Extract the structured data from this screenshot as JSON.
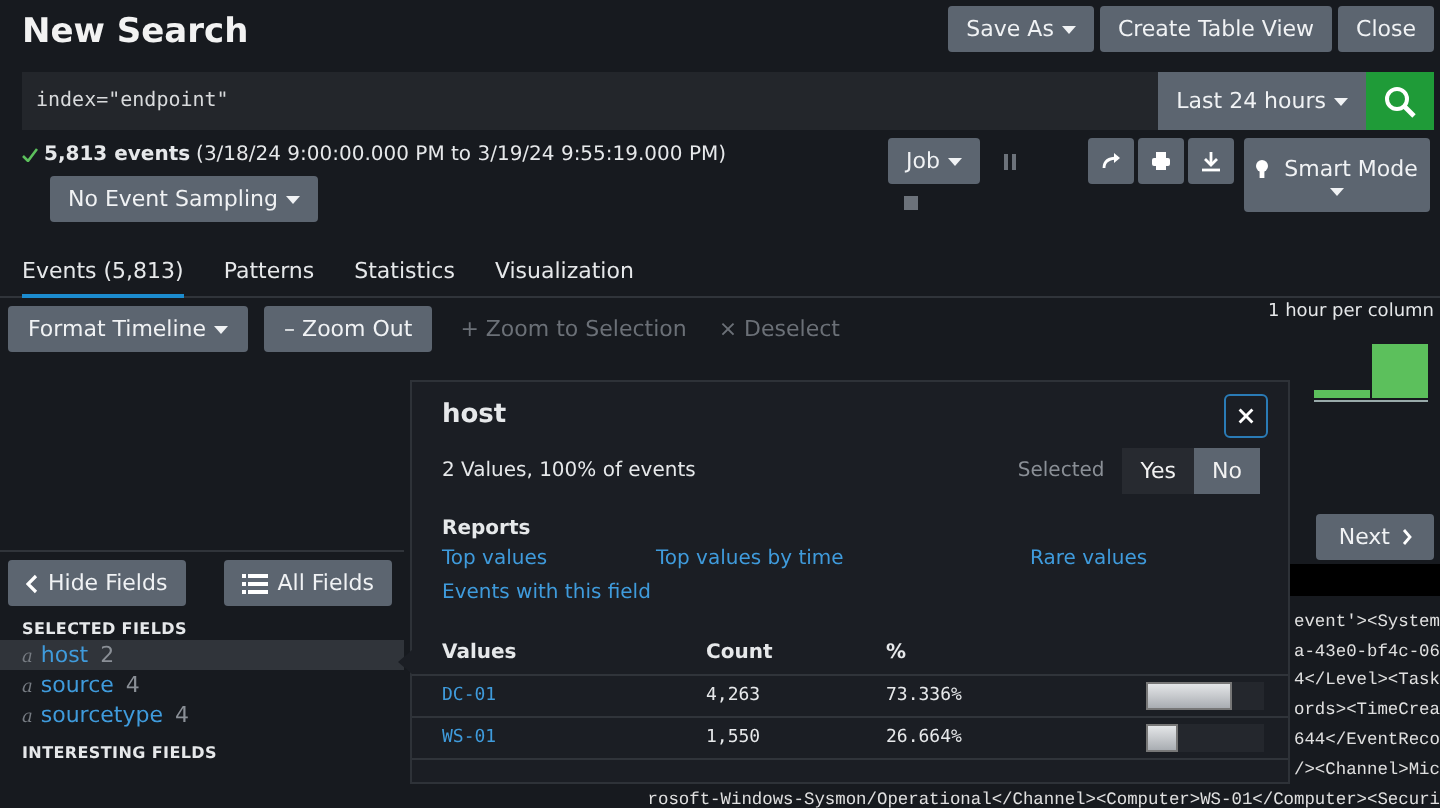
{
  "page": {
    "title": "New Search"
  },
  "header_buttons": [
    {
      "label": "Save As",
      "dropdown": true
    },
    {
      "label": "Create Table View",
      "dropdown": false
    },
    {
      "label": "Close",
      "dropdown": false
    }
  ],
  "search": {
    "query": "index=\"endpoint\"",
    "time_range": "Last 24 hours"
  },
  "job_status": {
    "count": "5,813 events",
    "range": "(3/18/24 9:00:00.000 PM to 3/19/24 9:55:19.000 PM)",
    "sampling": "No Event Sampling",
    "job": "Job",
    "mode": "Smart Mode"
  },
  "tabs": [
    {
      "label": "Events (5,813)",
      "selected": true
    },
    {
      "label": "Patterns",
      "selected": false
    },
    {
      "label": "Statistics",
      "selected": false
    },
    {
      "label": "Visualization",
      "selected": false
    }
  ],
  "timeline_toolbar": [
    {
      "label": "Format Timeline",
      "dropdown": true,
      "disabled": false
    },
    {
      "glyph": "–",
      "label": "Zoom Out",
      "dropdown": false,
      "disabled": false
    },
    {
      "glyph": "+",
      "label": "Zoom to Selection",
      "dropdown": false,
      "disabled": true
    },
    {
      "glyph": "×",
      "label": "Deselect",
      "dropdown": false,
      "disabled": true
    }
  ],
  "timeline": {
    "scale": "1 hour per column"
  },
  "pagination": {
    "next": "Next"
  },
  "sidebar": {
    "hide_fields": "Hide Fields",
    "all_fields": "All Fields",
    "sections": [
      {
        "heading": "SELECTED FIELDS",
        "fields": [
          {
            "type": "a",
            "name": "host",
            "count": "2",
            "selected": true
          },
          {
            "type": "a",
            "name": "source",
            "count": "4",
            "selected": false
          },
          {
            "type": "a",
            "name": "sourcetype",
            "count": "4",
            "selected": false
          }
        ]
      },
      {
        "heading": "INTERESTING FIELDS"
      }
    ]
  },
  "events": {
    "lines": [
      "event'><System",
      "a-43e0-bf4c-06",
      "4</Level><Task",
      "ords><TimeCrea",
      "644</EventReco",
      "/><Channel>Mic"
    ],
    "last_line": "rosoft-Windows-Sysmon/Operational</Channel><Computer>WS-01</Computer><Securi"
  },
  "field_popover": {
    "title": "host",
    "summary": "2 Values, 100% of events",
    "selected_label": "Selected",
    "selected_options": [
      {
        "label": "Yes",
        "selected": false
      },
      {
        "label": "No",
        "selected": true
      }
    ],
    "reports_heading": "Reports",
    "reports": [
      "Top values",
      "Top values by time",
      "Rare values",
      "Events with this field"
    ],
    "columns": [
      "Values",
      "Count",
      "%"
    ],
    "rows": [
      {
        "value": "DC-01",
        "count": "4,263",
        "percent": "73.336%",
        "level": 0.733
      },
      {
        "value": "WS-01",
        "count": "1,550",
        "percent": "26.664%",
        "level": 0.267
      }
    ]
  }
}
